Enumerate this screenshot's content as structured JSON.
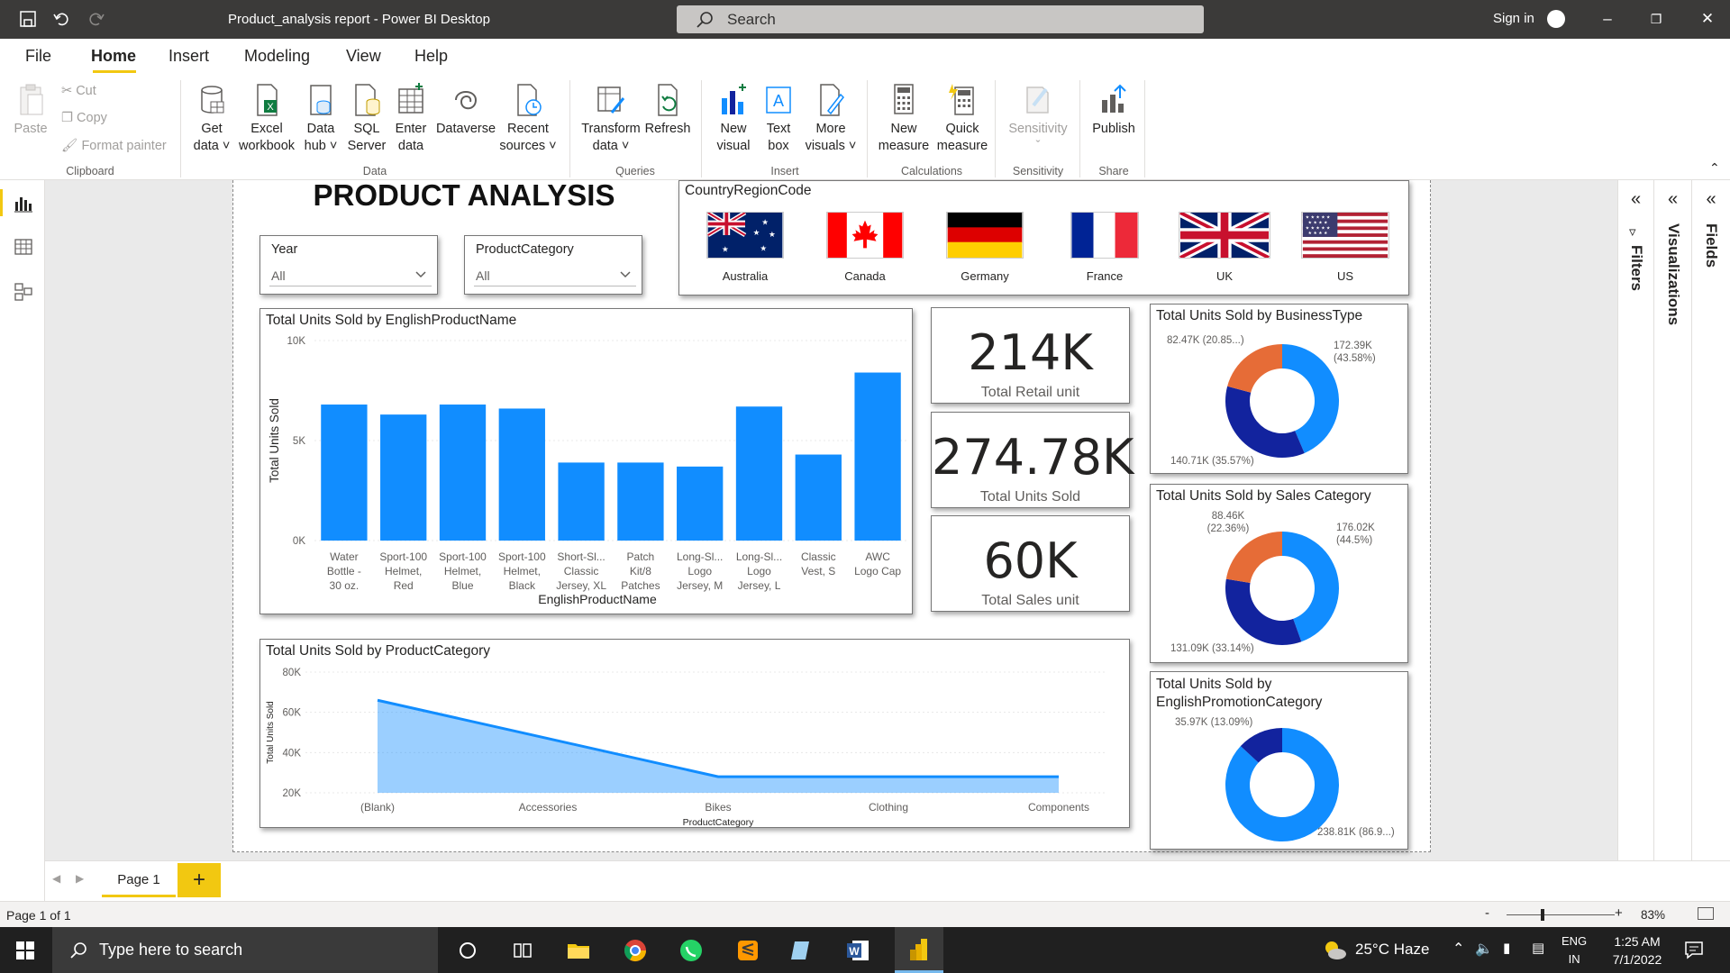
{
  "window": {
    "title": "Product_analysis report - Power BI Desktop",
    "search_placeholder": "Search",
    "sign_in": "Sign in"
  },
  "menu": {
    "tabs": [
      "File",
      "Home",
      "Insert",
      "Modeling",
      "View",
      "Help"
    ],
    "active": "Home"
  },
  "ribbon": {
    "clipboard": {
      "paste": "Paste",
      "cut": "Cut",
      "copy": "Copy",
      "format_painter": "Format painter",
      "group": "Clipboard"
    },
    "data": {
      "get_data": [
        "Get",
        "data ˅"
      ],
      "excel": [
        "Excel",
        "workbook"
      ],
      "data_hub": [
        "Data",
        "hub ˅"
      ],
      "sql": [
        "SQL",
        "Server"
      ],
      "enter_data": [
        "Enter",
        "data"
      ],
      "dataverse": [
        "Dataverse",
        ""
      ],
      "recent": [
        "Recent",
        "sources ˅"
      ],
      "group": "Data"
    },
    "queries": {
      "transform": [
        "Transform",
        "data ˅"
      ],
      "refresh": [
        "Refresh",
        ""
      ],
      "group": "Queries"
    },
    "insert": {
      "new_visual": [
        "New",
        "visual"
      ],
      "text_box": [
        "Text",
        "box"
      ],
      "more_visuals": [
        "More",
        "visuals ˅"
      ],
      "group": "Insert"
    },
    "calculations": {
      "new_measure": [
        "New",
        "measure"
      ],
      "quick_measure": [
        "Quick",
        "measure"
      ],
      "group": "Calculations"
    },
    "sensitivity": {
      "label": "Sensitivity",
      "group": "Sensitivity"
    },
    "share": {
      "publish": "Publish",
      "group": "Share"
    }
  },
  "panes": {
    "filters": "Filters",
    "visualizations": "Visualizations",
    "fields": "Fields"
  },
  "report": {
    "title": "PRODUCT ANALYSIS",
    "slicers": [
      {
        "label": "Year",
        "value": "All"
      },
      {
        "label": "ProductCategory",
        "value": "All"
      }
    ],
    "country_slicer": {
      "title": "CountryRegionCode",
      "countries": [
        "Australia",
        "Canada",
        "Germany",
        "France",
        "UK",
        "US"
      ]
    },
    "kpis": [
      {
        "value": "214K",
        "label": "Total Retail unit"
      },
      {
        "value": "274.78K",
        "label": "Total Units Sold"
      },
      {
        "value": "60K",
        "label": "Total Sales unit"
      }
    ],
    "donuts": [
      {
        "title": "Total Units Sold by BusinessType",
        "labels": [
          "82.47K (20.85...)",
          "172.39K (43.58%)",
          "140.71K (35.57%)"
        ]
      },
      {
        "title": "Total Units Sold by Sales Category",
        "labels": [
          "88.46K (22.36%)",
          "176.02K (44.5%)",
          "131.09K (33.14%)"
        ]
      },
      {
        "title": "Total Units Sold by EnglishPromotionCategory",
        "title_lines": [
          "Total Units Sold by",
          "EnglishPromotionCategory"
        ],
        "labels": [
          "35.97K (13.09%)",
          "238.81K (86.9...)"
        ]
      }
    ]
  },
  "chart_data": [
    {
      "type": "bar",
      "title": "Total Units Sold by EnglishProductName",
      "xlabel": "EnglishProductName",
      "ylabel": "Total Units Sold",
      "ylim": [
        0,
        10000
      ],
      "yticks": [
        "10K",
        "5K",
        "0K"
      ],
      "categories": [
        [
          "Water",
          "Bottle -",
          "30 oz."
        ],
        [
          "Sport-100",
          "Helmet,",
          "Red"
        ],
        [
          "Sport-100",
          "Helmet,",
          "Blue"
        ],
        [
          "Sport-100",
          "Helmet,",
          "Black"
        ],
        [
          "Short-Sl...",
          "Classic",
          "Jersey, XL"
        ],
        [
          "Patch",
          "Kit/8",
          "Patches"
        ],
        [
          "Long-Sl...",
          "Logo",
          "Jersey, M"
        ],
        [
          "Long-Sl...",
          "Logo",
          "Jersey, L"
        ],
        [
          "Classic",
          "Vest, S"
        ],
        [
          "AWC",
          "Logo Cap"
        ]
      ],
      "values": [
        6800,
        6300,
        6800,
        6600,
        3900,
        3900,
        3700,
        6700,
        4300,
        8400
      ],
      "color": "#118dff",
      "grid": true
    },
    {
      "type": "area",
      "title": "Total Units Sold by ProductCategory",
      "xlabel": "ProductCategory",
      "ylabel": "Total Units Sold",
      "ylim": [
        20000,
        80000
      ],
      "yticks": [
        "80K",
        "60K",
        "40K",
        "20K"
      ],
      "categories": [
        "(Blank)",
        "Accessories",
        "Bikes",
        "Clothing",
        "Components"
      ],
      "values": [
        66000,
        47000,
        28000,
        28000,
        28000
      ],
      "color": "#118dff",
      "grid": true
    },
    {
      "type": "pie",
      "title": "Total Units Sold by BusinessType",
      "values": [
        172390,
        140710,
        82470
      ],
      "colors": [
        "#118dff",
        "#12239e",
        "#e66c37"
      ]
    },
    {
      "type": "pie",
      "title": "Total Units Sold by Sales Category",
      "values": [
        176020,
        131090,
        88460
      ],
      "colors": [
        "#118dff",
        "#12239e",
        "#e66c37"
      ]
    },
    {
      "type": "pie",
      "title": "Total Units Sold by EnglishPromotionCategory",
      "values": [
        238810,
        35970
      ],
      "colors": [
        "#118dff",
        "#12239e"
      ]
    }
  ],
  "pages": {
    "tab": "Page 1",
    "add": "+",
    "status": "Page 1 of 1",
    "zoom": "83%"
  },
  "taskbar": {
    "search_placeholder": "Type here to search",
    "weather": "25°C  Haze",
    "lang": [
      "ENG",
      "IN"
    ],
    "time": "1:25 AM",
    "date": "7/1/2022"
  },
  "colors": {
    "accent": "#f2c811",
    "primary": "#118dff",
    "dark_blue": "#12239e",
    "orange": "#e66c37"
  }
}
